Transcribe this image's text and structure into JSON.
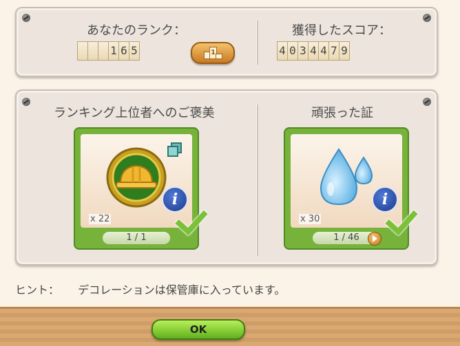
{
  "rank_panel": {
    "rank_label": "あなたのランク：",
    "rank_digits": [
      "",
      "",
      "",
      "1",
      "6",
      "5"
    ],
    "rank_button_label": "1",
    "score_label": "獲得したスコア：",
    "score_digits": [
      "4",
      "0",
      "3",
      "4",
      "4",
      "7",
      "9"
    ]
  },
  "rewards_panel": {
    "top_reward_title": "ランキング上位者へのご褒美",
    "top_reward": {
      "count": "x 22",
      "progress": "1 / 1",
      "icon": "hard-hat-coin-icon"
    },
    "effort_title": "頑張った証",
    "effort_reward": {
      "count": "x 30",
      "progress": "1 / 46",
      "icon": "water-drop-icon"
    }
  },
  "hint": {
    "label": "ヒント：",
    "text": "デコレーションは保管庫に入っています。"
  },
  "footer": {
    "ok_label": "OK"
  },
  "colors": {
    "accent_green": "#77b23b",
    "panel": "#ece4dd",
    "wood": "#d9a873"
  }
}
